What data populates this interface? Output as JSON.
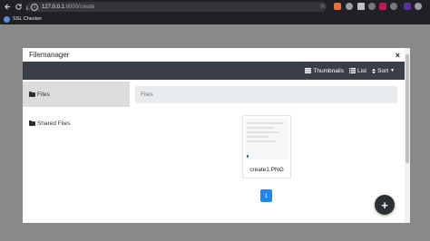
{
  "browser": {
    "url_host": "127.0.0.1",
    "url_path": ":8000/create",
    "bookmark_label": "SSL Checker"
  },
  "modal": {
    "title": "Filemanager",
    "close_glyph": "×"
  },
  "toolbar": {
    "thumbnails_label": "Thumbnails",
    "list_label": "List",
    "sort_label": "Sort"
  },
  "sidebar": {
    "items": [
      {
        "label": "Files",
        "active": true
      },
      {
        "label": "Shared Files",
        "active": false
      }
    ]
  },
  "breadcrumb": {
    "text": "Files"
  },
  "files": [
    {
      "name": "create1.PNG"
    }
  ],
  "pagination": {
    "current_page": "1"
  },
  "fab": {
    "label": "+"
  },
  "colors": {
    "toolbar_bg": "#3a3f47",
    "active_page": "#1e88f0",
    "fab_bg": "#2c3035",
    "chrome_bg": "#202124"
  }
}
